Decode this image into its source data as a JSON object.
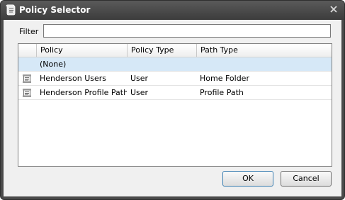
{
  "window": {
    "title": "Policy Selector",
    "title_icon": "scroll-icon",
    "close_icon": "close-icon"
  },
  "filter": {
    "label": "Filter",
    "value": "",
    "placeholder": ""
  },
  "grid": {
    "columns": [
      "Policy",
      "Policy Type",
      "Path Type"
    ],
    "rows": [
      {
        "policy": "(None)",
        "policy_type": "",
        "path_type": "",
        "icon": "",
        "selected": true
      },
      {
        "policy": "Henderson Users",
        "policy_type": "User",
        "path_type": "Home Folder",
        "icon": "policy-document-icon",
        "selected": false
      },
      {
        "policy": "Henderson Profile Path",
        "policy_type": "User",
        "path_type": "Profile Path",
        "icon": "policy-document-icon",
        "selected": false
      }
    ]
  },
  "buttons": {
    "ok_label": "OK",
    "cancel_label": "Cancel"
  },
  "colors": {
    "titlebar": "#4a4a4a",
    "selected_row": "#d6e8f7",
    "dialog_background": "#f0f0f0"
  }
}
